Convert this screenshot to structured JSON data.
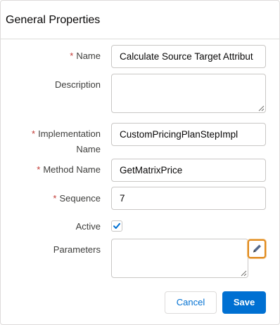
{
  "header": {
    "title": "General Properties"
  },
  "required_mark": "*",
  "fields": {
    "name": {
      "label": "Name",
      "value": "Calculate Source Target Attribut"
    },
    "description": {
      "label": "Description",
      "value": ""
    },
    "implementation_name": {
      "label_line1": "Implementation",
      "label_line2": "Name",
      "value": "CustomPricingPlanStepImpl"
    },
    "method_name": {
      "label": "Method Name",
      "value": "GetMatrixPrice"
    },
    "sequence": {
      "label": "Sequence",
      "value": "7"
    },
    "active": {
      "label": "Active",
      "checked": true
    },
    "parameters": {
      "label": "Parameters",
      "value": ""
    }
  },
  "buttons": {
    "cancel": "Cancel",
    "save": "Save"
  },
  "icons": {
    "checkmark": "checkmark-icon",
    "edit": "pencil-icon",
    "resize": "resize-grip-icon"
  },
  "colors": {
    "accent": "#0070d2",
    "required": "#c23934",
    "highlight": "#e08a1e"
  }
}
